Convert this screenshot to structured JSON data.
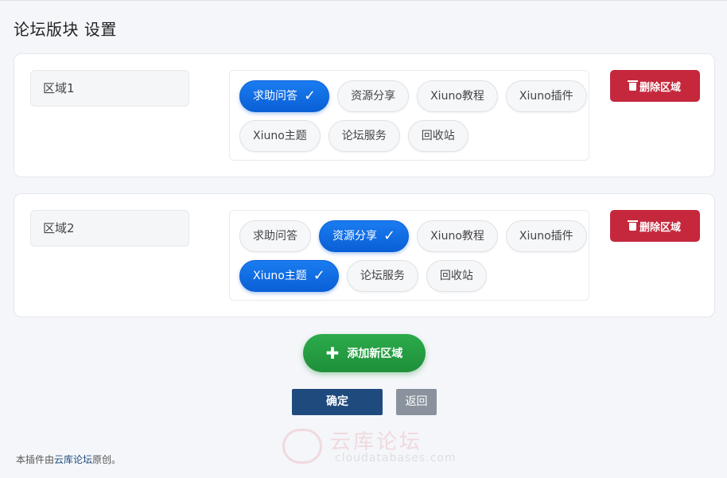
{
  "page": {
    "title": "论坛版块 设置"
  },
  "zones": [
    {
      "name": "区域1",
      "tags": [
        {
          "label": "求助问答",
          "selected": true
        },
        {
          "label": "资源分享",
          "selected": false
        },
        {
          "label": "Xiuno教程",
          "selected": false
        },
        {
          "label": "Xiuno插件",
          "selected": false
        },
        {
          "label": "Xiuno主题",
          "selected": false
        },
        {
          "label": "论坛服务",
          "selected": false
        },
        {
          "label": "回收站",
          "selected": false
        }
      ],
      "delete_label": "删除区域"
    },
    {
      "name": "区域2",
      "tags": [
        {
          "label": "求助问答",
          "selected": false
        },
        {
          "label": "资源分享",
          "selected": true
        },
        {
          "label": "Xiuno教程",
          "selected": false
        },
        {
          "label": "Xiuno插件",
          "selected": false
        },
        {
          "label": "Xiuno主题",
          "selected": true
        },
        {
          "label": "论坛服务",
          "selected": false
        },
        {
          "label": "回收站",
          "selected": false
        }
      ],
      "delete_label": "删除区域"
    }
  ],
  "actions": {
    "add_zone_label": "添加新区域",
    "confirm_label": "确定",
    "back_label": "返回"
  },
  "footer": {
    "prefix": "本插件由",
    "link_text": "云库论坛",
    "suffix": "原创。"
  },
  "watermark": {
    "title": "云库论坛",
    "subtitle": "cloudatabases.com"
  },
  "icons": {
    "check": "check-icon",
    "trash": "trash-icon",
    "plus": "plus-icon"
  },
  "colors": {
    "selected_tag": "#0a5fd6",
    "delete": "#c5283d",
    "add": "#2cab4b",
    "confirm": "#1f4a7e",
    "back": "#8a939d"
  }
}
